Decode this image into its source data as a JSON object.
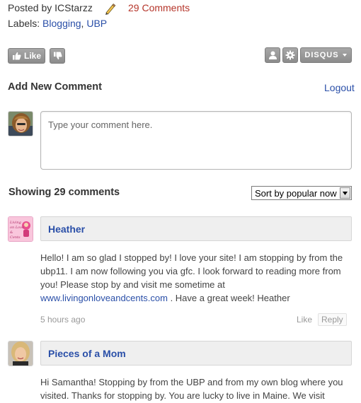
{
  "post": {
    "posted_by_prefix": "Posted by",
    "author": "ICStarzz",
    "comments_link": "29 Comments",
    "labels_prefix": "Labels:",
    "labels": [
      "Blogging",
      "UBP"
    ],
    "labels_separator": ","
  },
  "toolbar": {
    "like_label": "Like",
    "disqus_label": "DISQUS"
  },
  "add_comment": {
    "title": "Add New Comment",
    "logout_label": "Logout",
    "placeholder": "Type your comment here."
  },
  "comments_header": {
    "count_text": "Showing 29 comments",
    "sort_selected": "Sort by popular now"
  },
  "comments": [
    {
      "author": "Heather",
      "avatar_text": "Living on Love & Cents",
      "text_before_link": "Hello! I am so glad I stopped by! I love your site! I am stopping by from the ubp11. I am now following you via gfc. I look forward to reading more from you! Please stop by and visit me sometime at",
      "link": "www.livingonloveandcents.com",
      "text_after_link": ". Have a great week! Heather",
      "time": "5 hours ago",
      "like_label": "Like",
      "reply_label": "Reply"
    },
    {
      "author": "Pieces of a Mom",
      "text": "Hi Samantha! Stopping by from the UBP and from my own blog where you visited. Thanks for stopping by. You are lucky to live in Maine. We visit"
    }
  ],
  "colors": {
    "link": "#2a4fa8",
    "comments_link": "#b5352a",
    "button_gray": "#999999",
    "author_bar": "#efefef"
  },
  "icons": [
    "pencil-icon",
    "thumbs-up-icon",
    "thumbs-down-icon",
    "user-icon",
    "gear-icon",
    "caret-down-icon"
  ]
}
